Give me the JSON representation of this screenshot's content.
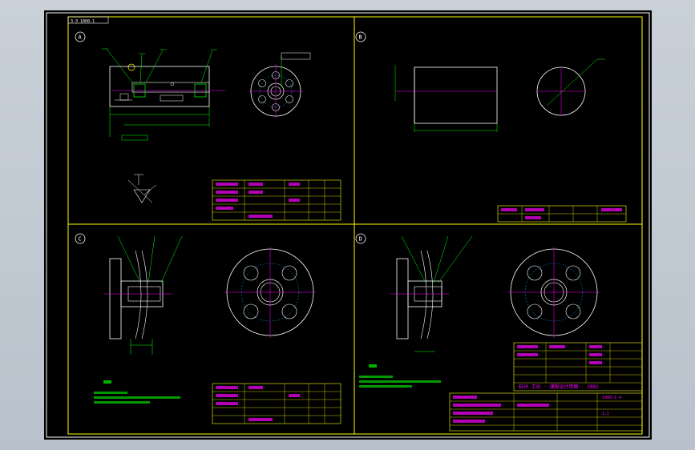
{
  "colors": {
    "background": "#000000",
    "border": "#ffff00",
    "geometry": "#ffffff",
    "annotation": "#00ff00",
    "table_text": "#ff00ff",
    "center_line": "#ff00ff",
    "hidden_line": "#00aaff"
  },
  "header_tag": "3-3 1000-1",
  "views": {
    "a": {
      "label": "A"
    },
    "b": {
      "label": "B"
    },
    "c": {
      "label": "C"
    },
    "d": {
      "label": "D"
    }
  },
  "title_block": {
    "institution": "杭州 工业 · 课程设计用图 · 2002",
    "drawing_no": "1000-1-4",
    "scale": "1:1"
  }
}
